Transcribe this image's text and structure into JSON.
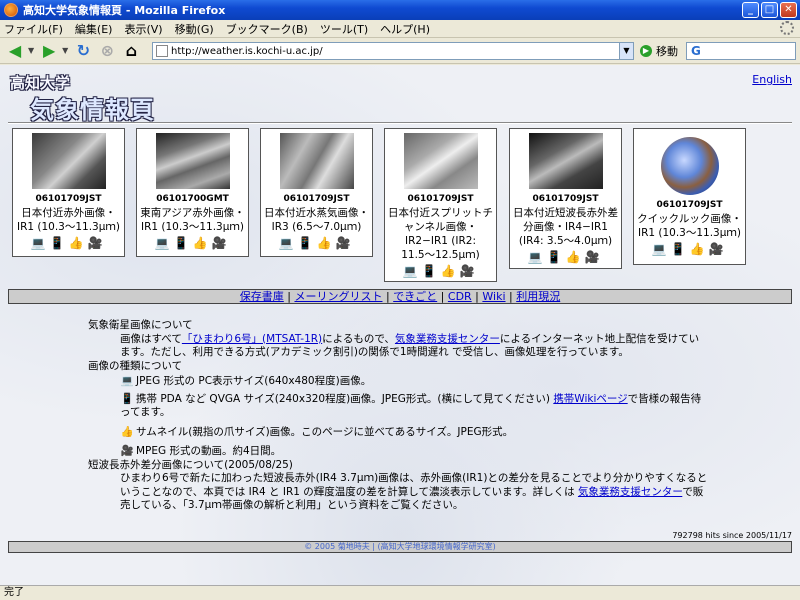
{
  "window": {
    "title": "高知大学気象情報頁 - Mozilla Firefox"
  },
  "menu": [
    "ファイル(F)",
    "編集(E)",
    "表示(V)",
    "移動(G)",
    "ブックマーク(B)",
    "ツール(T)",
    "ヘルプ(H)"
  ],
  "nav": {
    "url": "http://weather.is.kochi-u.ac.jp/",
    "go_label": "移動",
    "search_glyph": "G"
  },
  "header": {
    "logo_line1": "高知大学",
    "logo_line2": "気象情報頁",
    "english_link": "English"
  },
  "cards": [
    {
      "date": "06101709JST",
      "name": "日本付近赤外画像・IR1 (10.3〜11.3μｍ)"
    },
    {
      "date": "06101700GMT",
      "name": "東南アジア赤外画像・IR1 (10.3〜11.3μｍ)"
    },
    {
      "date": "06101709JST",
      "name": "日本付近水蒸気画像・IR3 (6.5〜7.0μｍ)"
    },
    {
      "date": "06101709JST",
      "name": "日本付近スプリットチャンネル画像・IR2−IR1 (IR2: 11.5〜12.5μｍ)"
    },
    {
      "date": "06101709JST",
      "name": "日本付近短波長赤外差分画像・IR4−IR1 (IR4: 3.5〜4.0μｍ)"
    },
    {
      "date": "06101709JST",
      "name": "クイックルック画像・IR1 (10.3〜11.3μｍ)"
    }
  ],
  "links": [
    "保存書庫",
    "メーリングリスト",
    "できごと",
    "CDR",
    "Wiki",
    "利用現況"
  ],
  "desc": {
    "h1": "気象衛星画像について",
    "p1_a": "画像はすべて",
    "p1_link1": "「ひまわり6号」(MTSAT-1R)",
    "p1_b": "によるもので、",
    "p1_link2": "気象業務支援センター",
    "p1_c": "によるインターネット地上配信を受けています。ただし、利用できる方式(アカデミック割引)の関係で1時間遅れ で受信し、画像処理を行っています。",
    "h2": "画像の種類について",
    "t1": "JPEG 形式の PC表示サイズ(640x480程度)画像。",
    "t2_a": "携帯 PDA など QVGA サイズ(240x320程度)画像。JPEG形式。(横にして見てください)",
    "t2_link": "携帯Wikiページ",
    "t2_b": "で皆様の報告待ってます。",
    "t3": "サムネイル(親指の爪サイズ)画像。このページに並べてあるサイズ。JPEG形式。",
    "t4": "MPEG 形式の動画。約4日間。",
    "h3": "短波長赤外差分画像について(2005/08/25)",
    "p3_a": "ひまわり6号で新たに加わった短波長赤外(IR4 3.7μｍ)画像は、赤外画像(IR1)との差分を見ることでより分かりやすくなるということなので、本頁では IR4 と IR1 の輝度温度の差を計算して濃淡表示しています。詳しくは",
    "p3_link": "気象業務支援センター",
    "p3_b": "で販売している、「3.7μｍ帯画像の解析と利用」という資料をご覧ください。"
  },
  "hits": "792798 hits since 2005/11/17",
  "footer": "© 2005 菊地時夫 | (高知大学地球環境情報学研究室)",
  "status": "完了"
}
